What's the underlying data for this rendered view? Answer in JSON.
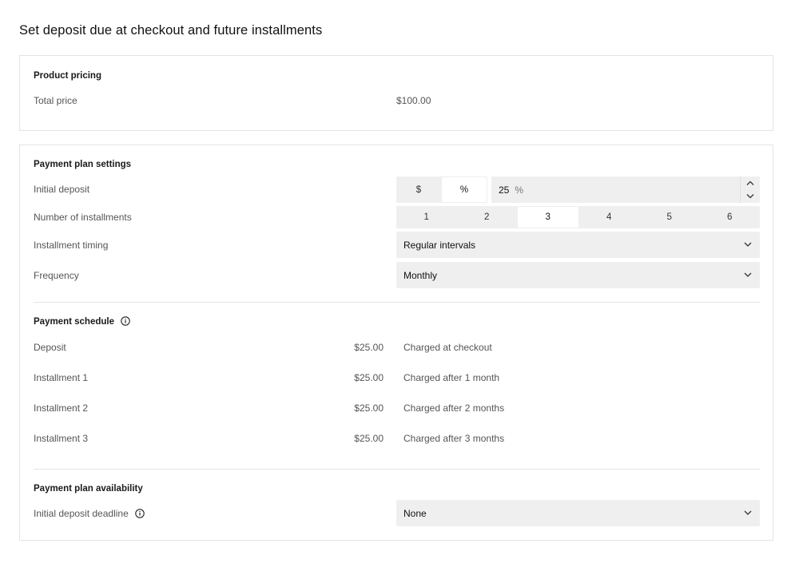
{
  "page_title": "Set deposit due at checkout and future installments",
  "product_pricing": {
    "title": "Product pricing",
    "total_price_label": "Total price",
    "total_price_value": "$100.00"
  },
  "plan_settings": {
    "title": "Payment plan settings",
    "initial_deposit_label": "Initial deposit",
    "deposit_unit_options": [
      "$",
      "%"
    ],
    "deposit_unit_selected": "%",
    "deposit_value": "25",
    "deposit_suffix": "%",
    "installments_label": "Number of installments",
    "installment_options": [
      "1",
      "2",
      "3",
      "4",
      "5",
      "6"
    ],
    "installments_selected": "3",
    "timing_label": "Installment timing",
    "timing_value": "Regular intervals",
    "frequency_label": "Frequency",
    "frequency_value": "Monthly"
  },
  "schedule": {
    "title": "Payment schedule",
    "rows": [
      {
        "label": "Deposit",
        "amount": "$25.00",
        "note": "Charged at checkout"
      },
      {
        "label": "Installment 1",
        "amount": "$25.00",
        "note": "Charged after 1 month"
      },
      {
        "label": "Installment 2",
        "amount": "$25.00",
        "note": "Charged after 2 months"
      },
      {
        "label": "Installment 3",
        "amount": "$25.00",
        "note": "Charged after 3 months"
      }
    ]
  },
  "availability": {
    "title": "Payment plan availability",
    "deadline_label": "Initial deposit deadline",
    "deadline_value": "None"
  },
  "icons": {
    "info": "info-icon",
    "chevron_down": "chevron-down-icon",
    "chevron_up": "chevron-up-icon"
  }
}
